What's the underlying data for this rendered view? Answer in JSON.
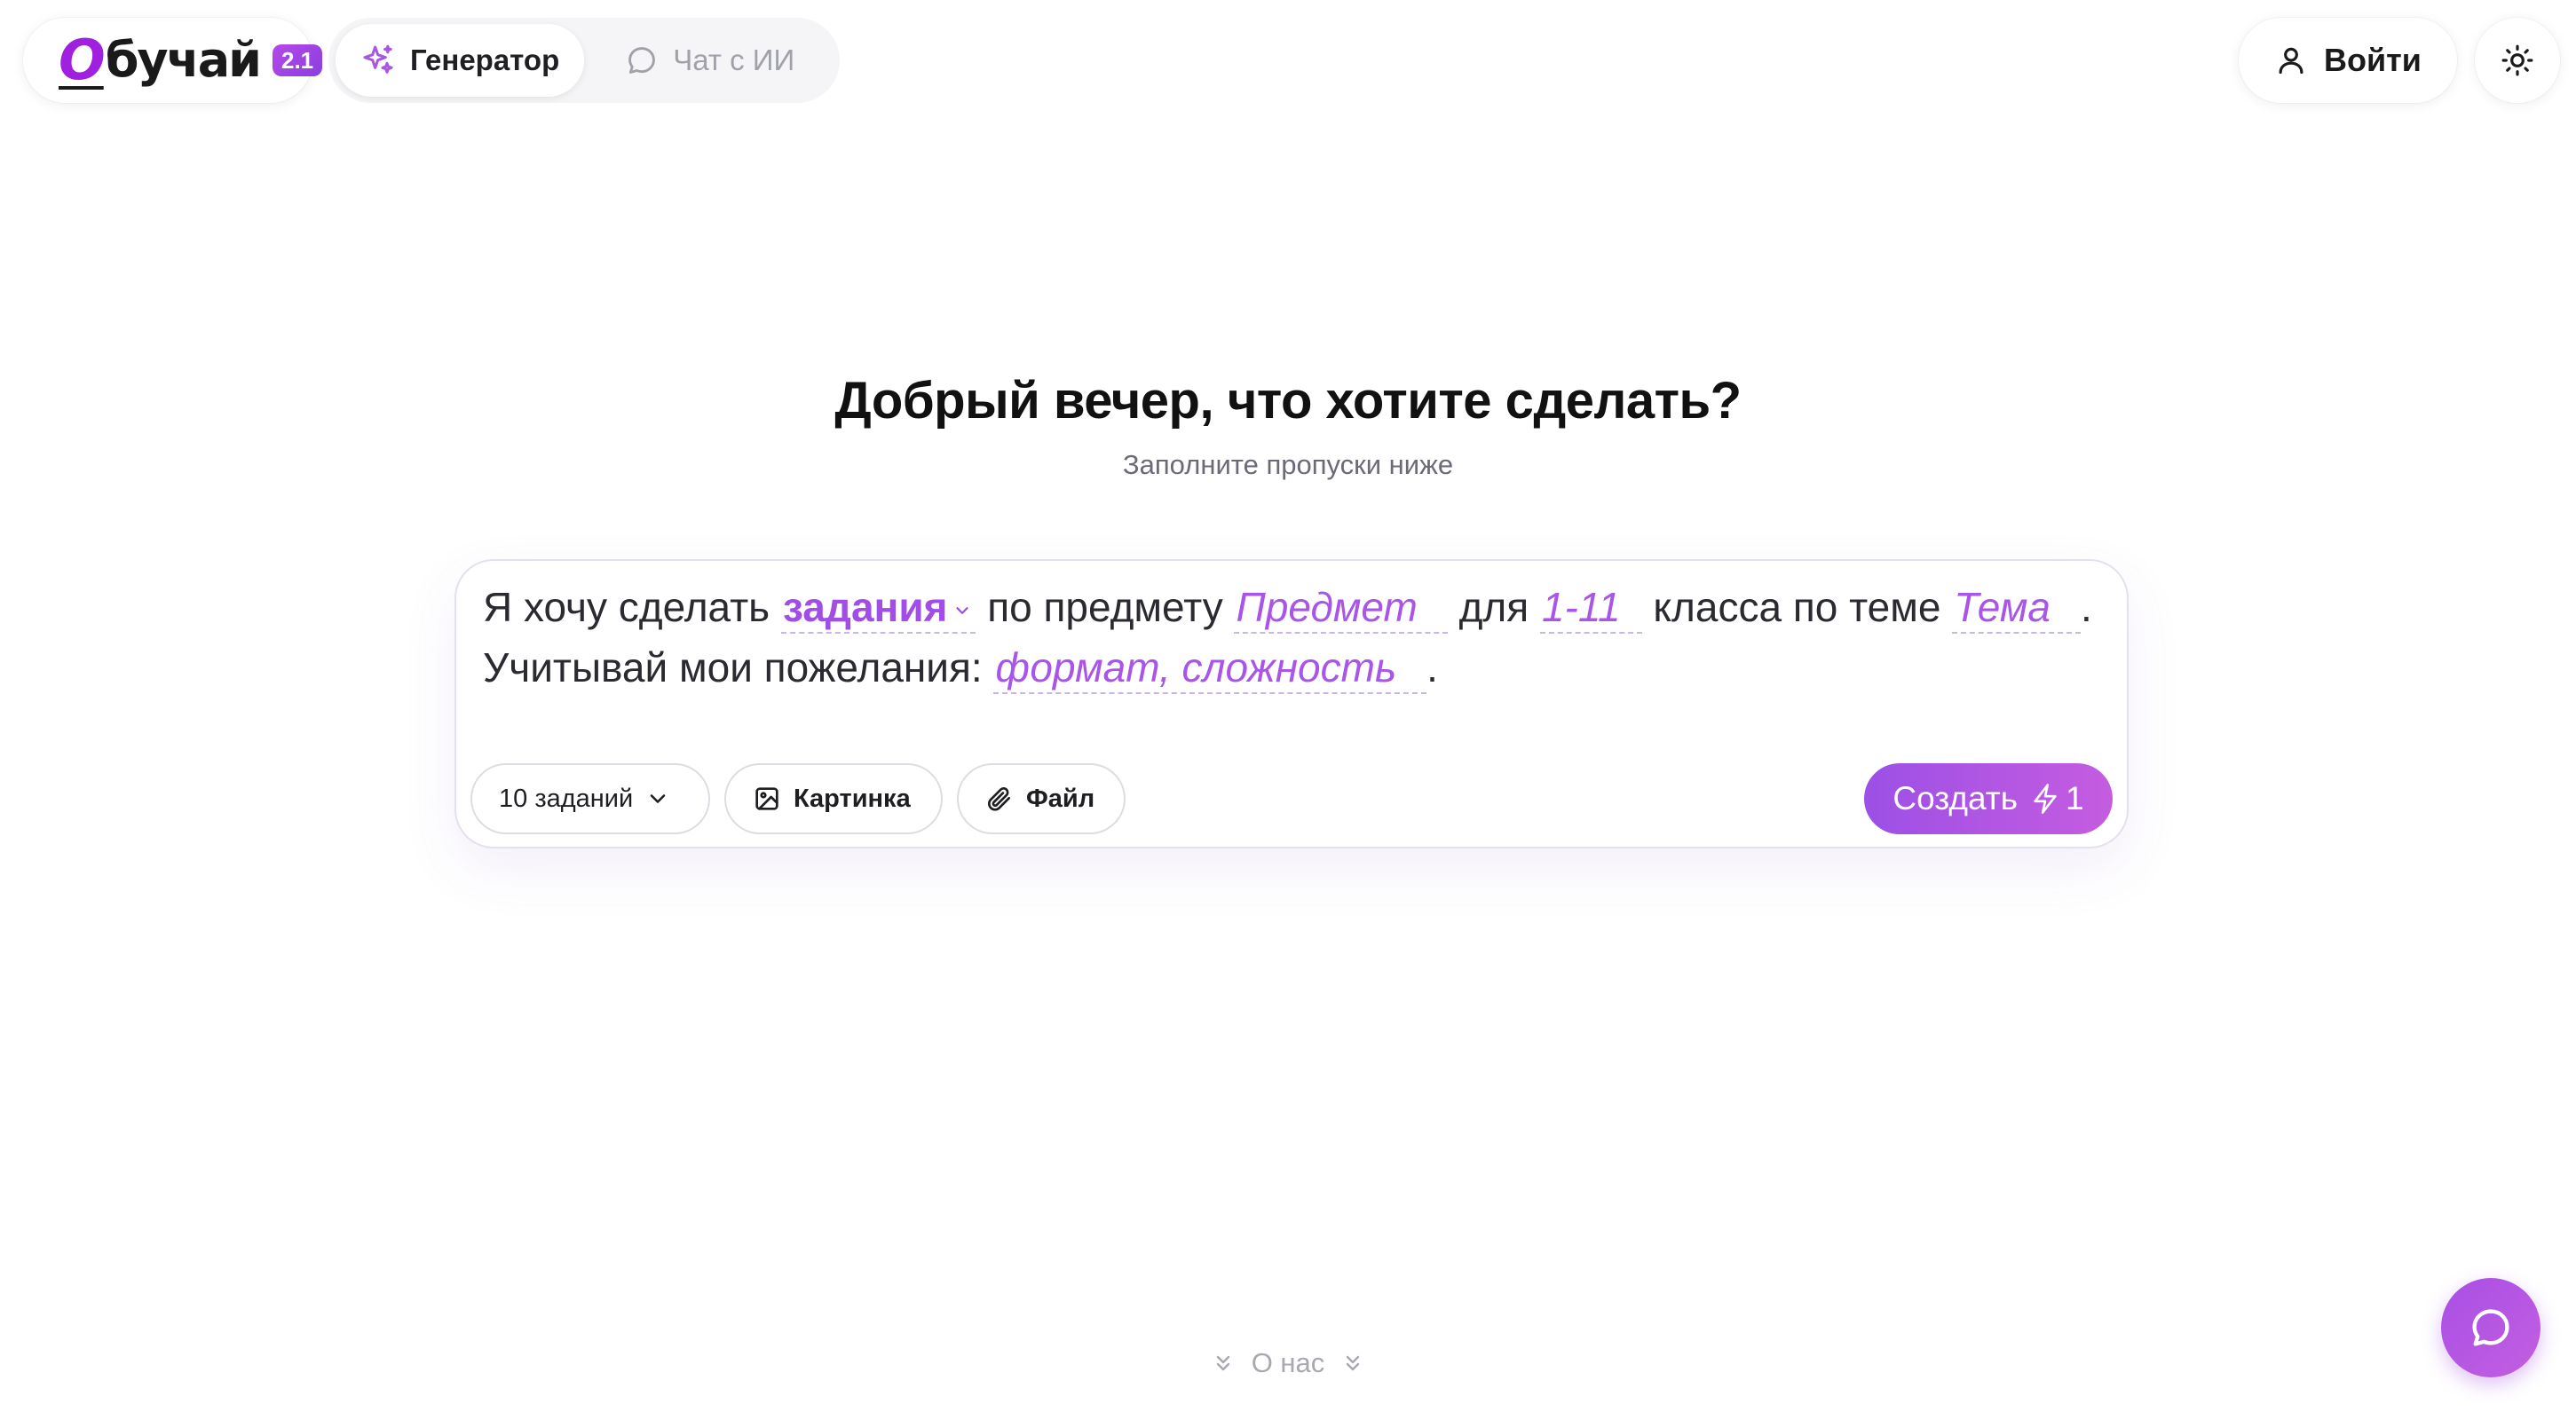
{
  "header": {
    "logo": {
      "first_letter": "О",
      "rest": "бучай",
      "version": "2.1"
    },
    "modes": [
      {
        "label": "Генератор",
        "icon": "sparkles-icon",
        "active": true
      },
      {
        "label": "Чат с ИИ",
        "icon": "chat-bubble-icon",
        "active": false
      }
    ],
    "login_label": "Войти",
    "theme_icon": "sun-icon"
  },
  "hero": {
    "title": "Добрый вечер, что хотите сделать?",
    "subtitle": "Заполните пропуски ниже"
  },
  "prompt": {
    "part1": "Я хочу сделать",
    "type_value": "задания",
    "part2": "по предмету",
    "subject_placeholder": "Предмет",
    "part3": "для",
    "grade_placeholder": "1-11",
    "part4": "класса по теме",
    "topic_placeholder": "Тема",
    "period1": ".",
    "part5": "Учитывай мои пожелания:",
    "wishes_placeholder": "формат, сложность",
    "period2": "."
  },
  "controls": {
    "count_label": "10 заданий",
    "image_label": "Картинка",
    "file_label": "Файл",
    "create_label": "Создать",
    "create_cost": "1"
  },
  "footer": {
    "about_label": "О нас"
  },
  "colors": {
    "accent": "#a855e8",
    "accent_gradient_start": "#9c50e6",
    "accent_gradient_end": "#c55ce0",
    "muted_text": "#6b6b78"
  }
}
